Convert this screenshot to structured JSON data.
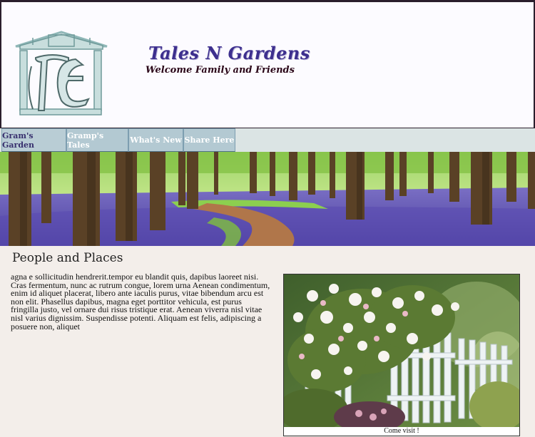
{
  "header": {
    "title": "Tales N Gardens",
    "tagline": "Welcome Family and Friends",
    "logo_icon": "house-monogram-logo"
  },
  "nav": {
    "tabs": [
      {
        "label": "Gram's Garden",
        "active": true
      },
      {
        "label": "Gramp's Tales",
        "active": false
      },
      {
        "label": "What's New",
        "active": false
      },
      {
        "label": "Share Here",
        "active": false
      }
    ]
  },
  "banner": {
    "image": "bluebell-forest-path"
  },
  "main": {
    "heading": "People and Places",
    "body": "agna e sollicitudin hendrerit.tempor eu blandit quis, dapibus laoreet nisi. Cras fermentum, nunc ac rutrum congue, lorem urna Aenean condimentum, enim id aliquet placerat, libero ante iaculis purus, vitae bibendum arcu est non elit. Phasellus dapibus, magna eget porttitor vehicula, est purus fringilla justo, vel ornare dui risus tristique erat. Aenean viverra nisl vitae nisl varius dignissim. Suspendisse potenti. Aliquam est felis, adipiscing a posuere non, aliquet",
    "photo": {
      "image": "garden-gate-roses",
      "caption": "Come visit !"
    }
  },
  "colors": {
    "title": "#3d2f8e",
    "tagline": "#2a0618",
    "nav_bar": "#dbe4e4",
    "nav_tab": "#b3c9d2",
    "page_bg": "#f3eeea"
  }
}
